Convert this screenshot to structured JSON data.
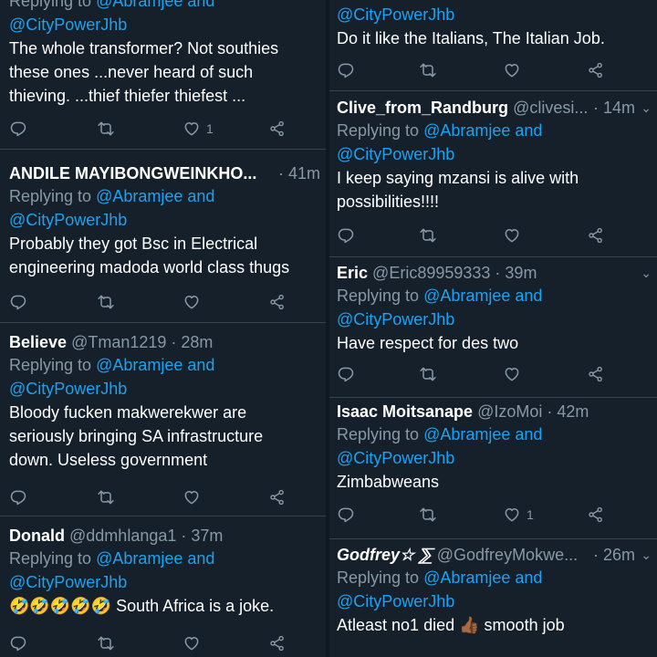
{
  "common": {
    "replying_prefix": "Replying to",
    "replying_mention1": "@Abramjee and",
    "replying_mention2": "@CityPowerJhb"
  },
  "left": [
    {
      "name": "",
      "handle": "",
      "time": "",
      "body": [
        "The whole transformer? Not southies",
        "these ones ...never heard of such",
        "thieving. ...thief thiefer thiefest ..."
      ],
      "like_count": "1",
      "top_reply": "Replying to @Abramjee and"
    },
    {
      "name": "ANDILE MAYIBONGWEINKHO...",
      "handle": "",
      "time": "· 41m",
      "body": [
        "Probably they got Bsc in Electrical",
        "engineering madoda world class thugs"
      ],
      "like_count": ""
    },
    {
      "name": "Believe",
      "handle": "@Tman1219",
      "time": "· 28m",
      "body": [
        "Bloody fucken makwerekwer are",
        "seriously bringing SA infrastructure",
        "down. Useless government"
      ],
      "like_count": ""
    },
    {
      "name": "Donald",
      "handle": "@ddmhlanga1",
      "time": "· 37m",
      "emoji": "🤣🤣🤣🤣🤣",
      "body": [
        "South Africa is a joke."
      ],
      "like_count": ""
    }
  ],
  "right": [
    {
      "name": "",
      "handle": "",
      "time": "",
      "body": [
        "Do it like the Italians, The Italian Job."
      ],
      "like_count": ""
    },
    {
      "name": "Clive_from_Randburg",
      "handle": "@clivesi...",
      "time": "· 14m",
      "body": [
        "I keep saying mzansi is alive with",
        "possibilities!!!!"
      ],
      "like_count": ""
    },
    {
      "name": "Eric",
      "handle": "@Eric89959333",
      "time": "· 39m",
      "body": [
        "Have respect for des two"
      ],
      "like_count": ""
    },
    {
      "name": "Isaac Moitsanape",
      "handle": "@IzoMoi",
      "time": "· 42m",
      "body": [
        "Zimbabweans"
      ],
      "like_count": "1"
    },
    {
      "name": "Godfrey☆ ⅀",
      "handle": "@GodfreyMokwe...",
      "time": "· 26m",
      "body_pre": "Atleast no1 died",
      "body_emoji": "👍🏾",
      "body_post": "smooth job",
      "like_count": ""
    }
  ],
  "icons": {
    "reply": "reply-icon",
    "retweet": "retweet-icon",
    "like": "like-icon",
    "share": "share-icon",
    "caret": "chevron-down-icon"
  },
  "colors": {
    "background": "#15202b",
    "link": "#1da1f2",
    "muted": "#8899a6",
    "border": "#38444d"
  }
}
